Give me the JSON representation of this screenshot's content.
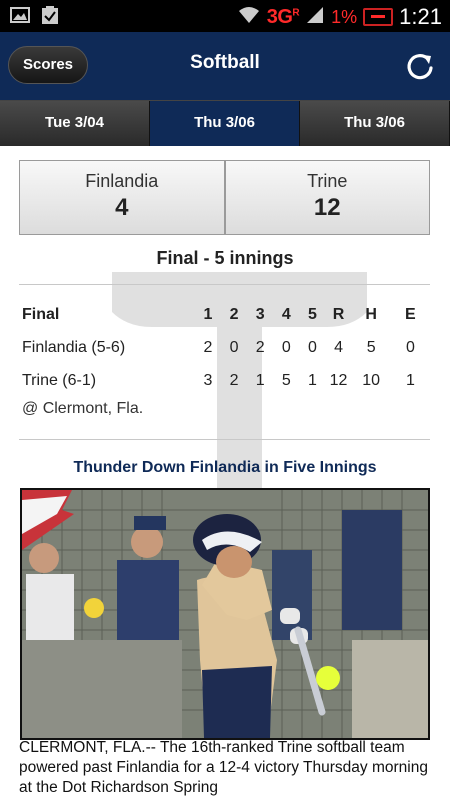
{
  "status_bar": {
    "network": "3G",
    "network_sup": "R",
    "battery_pct": "1%",
    "time": "1:21",
    "icons": [
      "image-icon",
      "clipboard-icon",
      "wifi-icon",
      "signal-icon",
      "battery-icon"
    ]
  },
  "header": {
    "back_label": "Scores",
    "title": "Softball",
    "refresh_icon": "refresh-icon",
    "bg_color": "#0f2a57"
  },
  "date_tabs": [
    {
      "label": "Tue 3/04",
      "active": false
    },
    {
      "label": "Thu 3/06",
      "active": true
    },
    {
      "label": "Thu 3/06",
      "active": false
    }
  ],
  "scoreboard": {
    "away": {
      "name": "Finlandia",
      "score": "4"
    },
    "home": {
      "name": "Trine",
      "score": "12"
    }
  },
  "game_status": "Final - 5 innings",
  "linescore": {
    "header": [
      "Final",
      "1",
      "2",
      "3",
      "4",
      "5",
      "R",
      "H",
      "E"
    ],
    "rows": [
      [
        "Finlandia (5-6)",
        "2",
        "0",
        "2",
        "0",
        "0",
        "4",
        "5",
        "0"
      ],
      [
        "Trine (6-1)",
        "3",
        "2",
        "1",
        "5",
        "1",
        "12",
        "10",
        "1"
      ]
    ],
    "location": "@ Clermont, Fla."
  },
  "story": {
    "headline": "Thunder Down Finlandia in Five Innings",
    "photo_alt": "softball-batter-photo",
    "text": "CLERMONT, FLA.-- The 16th-ranked Trine softball team powered past Finlandia for a 12-4 victory Thursday morning at the Dot Richardson Spring"
  }
}
